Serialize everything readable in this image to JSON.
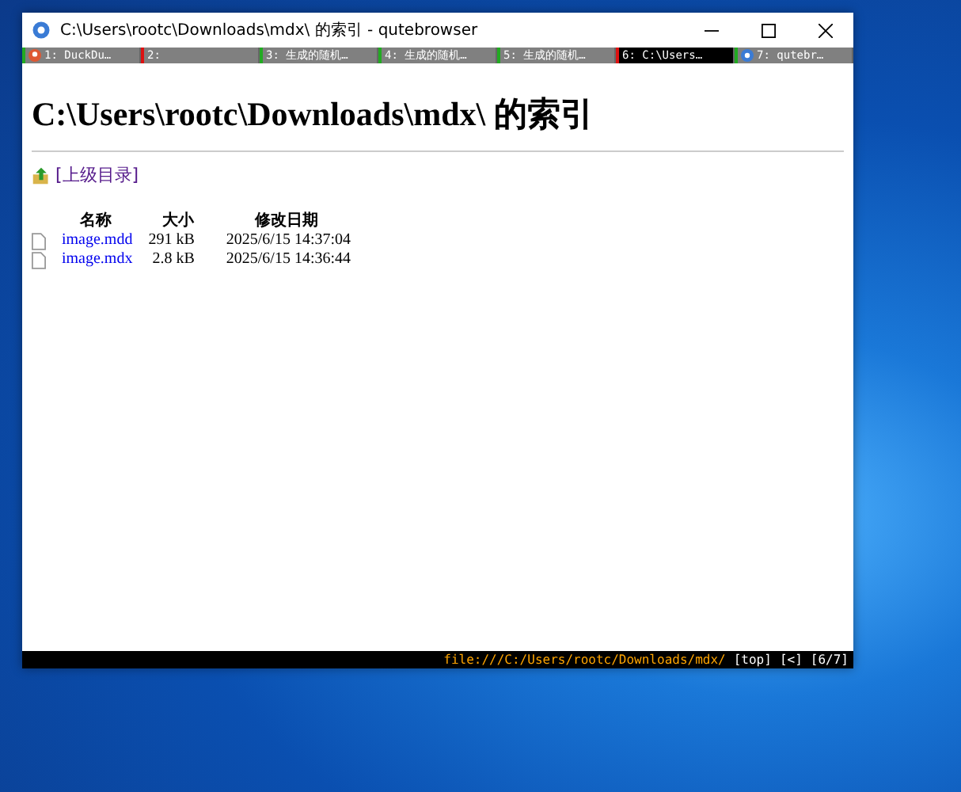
{
  "window": {
    "title": "C:\\Users\\rootc\\Downloads\\mdx\\ 的索引 - qutebrowser"
  },
  "tabs": [
    {
      "label": "1: DuckDu…",
      "selected": false,
      "color": "#22aa22",
      "kind": "duck"
    },
    {
      "label": "2:",
      "selected": false,
      "color": "#dd1111",
      "kind": "none"
    },
    {
      "label": "3: 生成的随机…",
      "selected": false,
      "color": "#22aa22",
      "kind": "none"
    },
    {
      "label": "4: 生成的随机…",
      "selected": false,
      "color": "#22aa22",
      "kind": "none"
    },
    {
      "label": "5: 生成的随机…",
      "selected": false,
      "color": "#22aa22",
      "kind": "none"
    },
    {
      "label": "6: C:\\Users…",
      "selected": true,
      "color": "#dd1111",
      "kind": "none"
    },
    {
      "label": "7: qutebr…",
      "selected": false,
      "color": "#22aa22",
      "kind": "qute"
    }
  ],
  "page": {
    "heading": "C:\\Users\\rootc\\Downloads\\mdx\\ 的索引",
    "parent_link": "[上级目录]",
    "columns": [
      "名称",
      "大小",
      "修改日期"
    ],
    "rows": [
      {
        "name": "image.mdd",
        "size": "291 kB",
        "modified": "2025/6/15 14:37:04"
      },
      {
        "name": "image.mdx",
        "size": "2.8 kB",
        "modified": "2025/6/15 14:36:44"
      }
    ]
  },
  "status_bar": {
    "url": "file:///C:/Users/rootc/Downloads/mdx/",
    "position": "[top]",
    "history": "[<]",
    "tab_index": "[6/7]"
  }
}
